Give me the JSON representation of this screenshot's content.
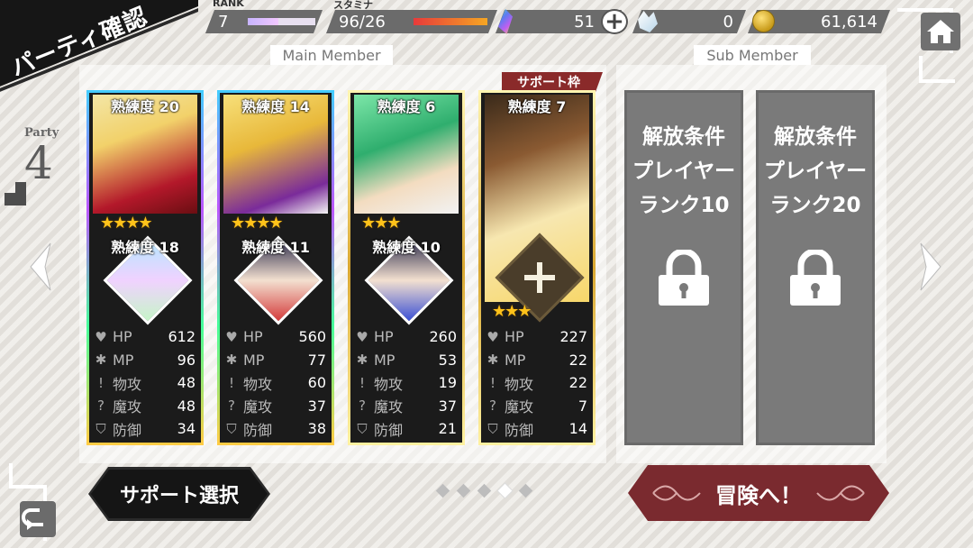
{
  "header": {
    "title": "パーティ確認",
    "rank_label": "RANK",
    "rank_value": "7",
    "rank_progress": 0.45,
    "stamina_label": "スタミナ",
    "stamina_value": "96/26",
    "stamina_progress": 1.0,
    "gems": "51",
    "crystals": "0",
    "gold": "61,614",
    "plus": "+",
    "icons": {
      "gem": "gem-icon",
      "crystal": "crystal-icon",
      "coin": "coin-icon",
      "home": "home-icon"
    }
  },
  "sections": {
    "main_label": "Main Member",
    "sub_label": "Sub Member",
    "support_tag": "サポート枠"
  },
  "party": {
    "label": "Party",
    "number": "4"
  },
  "cards": [
    {
      "mastery": "熟練度 20",
      "stars": "★★★★",
      "sub_mastery": "熟練度 18",
      "hp": "612",
      "mp": "96",
      "atk": "48",
      "matk": "48",
      "def": "34"
    },
    {
      "mastery": "熟練度 14",
      "stars": "★★★★",
      "sub_mastery": "熟練度 11",
      "hp": "560",
      "mp": "77",
      "atk": "60",
      "matk": "37",
      "def": "38"
    },
    {
      "mastery": "熟練度 6",
      "stars": "★★★",
      "sub_mastery": "熟練度 10",
      "hp": "260",
      "mp": "53",
      "atk": "19",
      "matk": "37",
      "def": "21"
    },
    {
      "mastery": "熟練度 7",
      "stars": "★★★",
      "sub_mastery": "",
      "hp": "227",
      "mp": "22",
      "atk": "22",
      "matk": "7",
      "def": "14"
    }
  ],
  "stat_labels": {
    "hp": "HP",
    "mp": "MP",
    "atk": "物攻",
    "matk": "魔攻",
    "def": "防御"
  },
  "sub_slots": [
    {
      "line1": "解放条件",
      "line2": "プレイヤー",
      "line3": "ランク10"
    },
    {
      "line1": "解放条件",
      "line2": "プレイヤー",
      "line3": "ランク20"
    }
  ],
  "buttons": {
    "support": "サポート選択",
    "adventure": "冒険へ！"
  },
  "pagination": {
    "count": 5,
    "active": 3
  },
  "colors": {
    "accent_red": "#7a2a2f",
    "dark": "#151515",
    "gold": "#d9a730"
  }
}
